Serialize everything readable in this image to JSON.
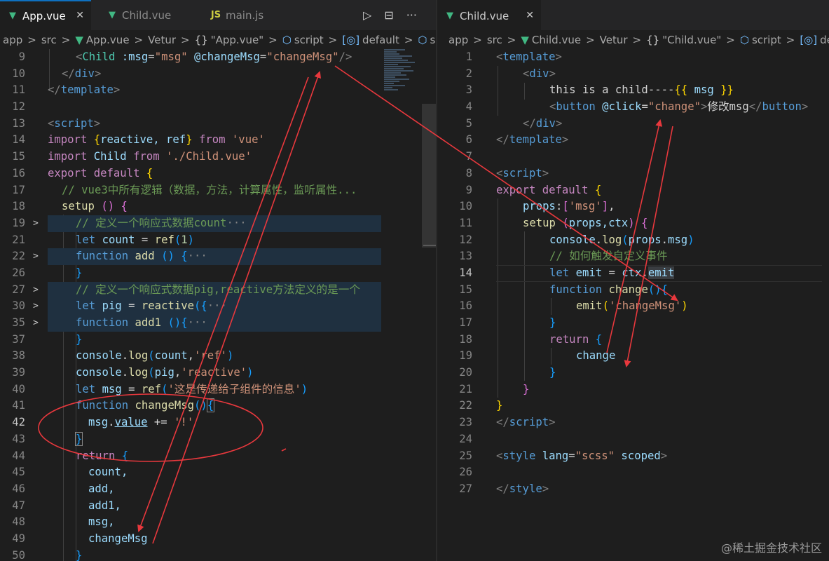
{
  "left": {
    "tabs": [
      {
        "label": "App.vue",
        "icon": "vue-icon",
        "active": true
      },
      {
        "label": "Child.vue",
        "icon": "vue-icon",
        "active": false
      },
      {
        "label": "main.js",
        "icon": "js-icon",
        "active": false
      }
    ],
    "js_icon_text": "JS",
    "actions": [
      "▷",
      "⊟",
      "···"
    ],
    "breadcrumb": [
      "app",
      "src",
      "App.vue",
      "Vetur",
      "\"App.vue\"",
      "script",
      "default",
      "setup"
    ],
    "lines": [
      {
        "n": "9"
      },
      {
        "n": "10"
      },
      {
        "n": "11"
      },
      {
        "n": "12"
      },
      {
        "n": "13"
      },
      {
        "n": "14"
      },
      {
        "n": "15"
      },
      {
        "n": "16"
      },
      {
        "n": "17"
      },
      {
        "n": "18"
      },
      {
        "n": "19"
      },
      {
        "n": "21"
      },
      {
        "n": "22"
      },
      {
        "n": "26"
      },
      {
        "n": "27"
      },
      {
        "n": "30"
      },
      {
        "n": "35"
      },
      {
        "n": "37"
      },
      {
        "n": "38"
      },
      {
        "n": "39"
      },
      {
        "n": "40"
      },
      {
        "n": "41"
      },
      {
        "n": "42"
      },
      {
        "n": "43"
      },
      {
        "n": "44"
      },
      {
        "n": "45"
      },
      {
        "n": "46"
      },
      {
        "n": "47"
      },
      {
        "n": "48"
      },
      {
        "n": "49"
      },
      {
        "n": "50"
      }
    ],
    "code": {
      "l9_tag": "Child",
      "l9_attr1": ":msg",
      "l9_val1": "\"msg\"",
      "l9_attr2": "@changeMsg",
      "l9_val2": "\"changeMsg\"",
      "l10": "div",
      "l11": "template",
      "l13": "script",
      "l14_import": "import",
      "l14_names": "reactive, ref",
      "l14_from": "from",
      "l14_src": "'vue'",
      "l15_import": "import",
      "l15_name": "Child",
      "l15_from": "from",
      "l15_src": "'./Child.vue'",
      "l16_export": "export",
      "l16_default": "default",
      "l17": "// vue3中所有逻辑（数据，方法，计算属性，监听属性...",
      "l18": "setup",
      "l19": "// 定义一个响应式数据count",
      "l21_let": "let",
      "l21_var": "count",
      "l21_fn": "ref",
      "l21_num": "1",
      "l22_kw": "function",
      "l22_fn": "add",
      "l27": "// 定义一个响应式数据pig,reactive方法定义的是一个",
      "l30_let": "let",
      "l30_var": "pig",
      "l30_fn": "reactive",
      "l35_kw": "function",
      "l35_fn": "add1",
      "l38_obj": "console",
      "l38_fn": "log",
      "l38_a": "count",
      "l38_s": "'ref'",
      "l39_obj": "console",
      "l39_fn": "log",
      "l39_a": "pig",
      "l39_s": "'reactive'",
      "l40_let": "let",
      "l40_var": "msg",
      "l40_fn": "ref",
      "l40_s": "'这是传递给子组件的信息'",
      "l41_kw": "function",
      "l41_fn": "changeMsg",
      "l42_obj": "msg",
      "l42_prop": "value",
      "l42_s": "'!'",
      "l44": "return",
      "l45": "count,",
      "l46": "add,",
      "l47": "add1,",
      "l48": "msg,",
      "l49": "changeMsg"
    }
  },
  "right": {
    "tab": {
      "label": "Child.vue",
      "icon": "vue-icon"
    },
    "breadcrumb": [
      "app",
      "src",
      "Child.vue",
      "Vetur",
      "\"Child.vue\"",
      "script",
      "default"
    ],
    "lines": [
      {
        "n": "1"
      },
      {
        "n": "2"
      },
      {
        "n": "3"
      },
      {
        "n": "4"
      },
      {
        "n": "5"
      },
      {
        "n": "6"
      },
      {
        "n": "7"
      },
      {
        "n": "8"
      },
      {
        "n": "9"
      },
      {
        "n": "10"
      },
      {
        "n": "11"
      },
      {
        "n": "12"
      },
      {
        "n": "13"
      },
      {
        "n": "14"
      },
      {
        "n": "15"
      },
      {
        "n": "16"
      },
      {
        "n": "17"
      },
      {
        "n": "18"
      },
      {
        "n": "19"
      },
      {
        "n": "20"
      },
      {
        "n": "21"
      },
      {
        "n": "22"
      },
      {
        "n": "23"
      },
      {
        "n": "24"
      },
      {
        "n": "25"
      },
      {
        "n": "26"
      },
      {
        "n": "27"
      }
    ],
    "code": {
      "r1": "template",
      "r2": "div",
      "r3_text": "this is a child----",
      "r3_var": "msg",
      "r4_tag": "button",
      "r4_attr": "@click",
      "r4_val": "\"change\"",
      "r4_text": "修改msg",
      "r5": "div",
      "r6": "template",
      "r8": "script",
      "r9_export": "export",
      "r9_default": "default",
      "r10_key": "props",
      "r10_s": "'msg'",
      "r11_fn": "setup",
      "r11_p": "props,ctx",
      "r12_obj": "console",
      "r12_fn": "log",
      "r12_a": "props",
      "r12_b": "msg",
      "r13": "// 如何触发自定义事件",
      "r14_let": "let",
      "r14_var": "emit",
      "r14_obj": "ctx",
      "r14_prop": "emit",
      "r15_kw": "function",
      "r15_fn": "change",
      "r16_fn": "emit",
      "r16_s": "'changeMsg'",
      "r18": "return",
      "r19": "change",
      "r23": "script",
      "r25_tag": "style",
      "r25_attr": "lang",
      "r25_val": "\"scss\"",
      "r25_attr2": "scoped",
      "r27": "style"
    }
  },
  "watermark": "@稀土掘金技术社区",
  "annotation_color": "#e8383d"
}
